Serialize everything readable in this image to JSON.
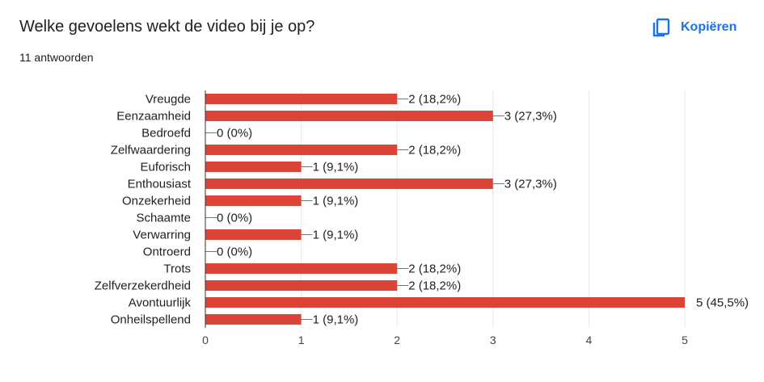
{
  "header": {
    "question": "Welke gevoelens wekt de video bij je op?",
    "responses": "11 antwoorden",
    "copy_label": "Kopiëren",
    "copy_icon": "copy-icon",
    "accent_color": "#1a73e8"
  },
  "chart_data": {
    "type": "bar",
    "orientation": "horizontal",
    "categories": [
      "Vreugde",
      "Eenzaamheid",
      "Bedroefd",
      "Zelfwaardering",
      "Euforisch",
      "Enthousiast",
      "Onzekerheid",
      "Schaamte",
      "Verwarring",
      "Ontroerd",
      "Trots",
      "Zelfverzekerdheid",
      "Avontuurlijk",
      "Onheilspellend"
    ],
    "values": [
      2,
      3,
      0,
      2,
      1,
      3,
      1,
      0,
      1,
      0,
      2,
      2,
      5,
      1
    ],
    "value_labels": [
      "2 (18,2%)",
      "3 (27,3%)",
      "0 (0%)",
      "2 (18,2%)",
      "1 (9,1%)",
      "3 (27,3%)",
      "1 (9,1%)",
      "0 (0%)",
      "1 (9,1%)",
      "0 (0%)",
      "2 (18,2%)",
      "2 (18,2%)",
      "5 (45,5%)",
      "1 (9,1%)"
    ],
    "xticks": [
      "0",
      "1",
      "2",
      "3",
      "4",
      "5"
    ],
    "xlim": [
      0,
      5
    ],
    "grid": true,
    "bar_color": "#dc4437"
  }
}
